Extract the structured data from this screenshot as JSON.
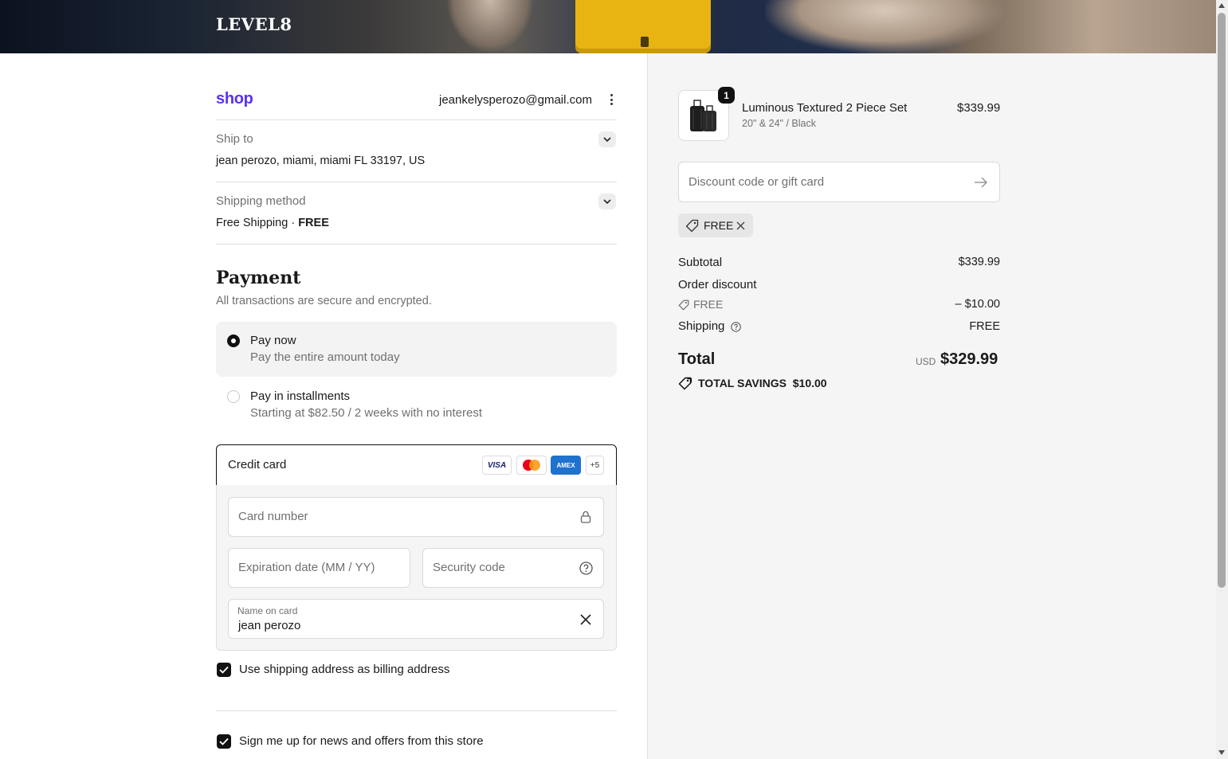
{
  "header": {
    "brand": "LEVEL8"
  },
  "contact": {
    "shop_brand": "shop",
    "email": "jeankelysperozo@gmail.com"
  },
  "ship_to": {
    "label": "Ship to",
    "value": "jean perozo, miami, miami FL 33197, US"
  },
  "shipping_method": {
    "label": "Shipping method",
    "value": "Free Shipping",
    "separator": "·",
    "price": "FREE"
  },
  "payment": {
    "title": "Payment",
    "subtitle": "All transactions are secure and encrypted.",
    "options": [
      {
        "title": "Pay now",
        "subtitle": "Pay the entire amount today",
        "selected": true
      },
      {
        "title": "Pay in installments",
        "subtitle": "Starting at $82.50 / 2 weeks with no interest",
        "selected": false
      }
    ],
    "credit_card": {
      "label": "Credit card",
      "badges": {
        "visa": "VISA",
        "amex": "AMEX",
        "more": "+5"
      },
      "card_number_placeholder": "Card number",
      "expiration_placeholder": "Expiration date (MM / YY)",
      "security_placeholder": "Security code",
      "name_label": "Name on card",
      "name_value": "jean perozo"
    },
    "billing_checkbox": {
      "label": "Use shipping address as billing address",
      "checked": true
    },
    "newsletter_checkbox": {
      "label": "Sign me up for news and offers from this store",
      "checked": true
    }
  },
  "summary": {
    "product": {
      "quantity": "1",
      "name": "Luminous Textured 2 Piece Set",
      "variant": "20\" & 24\" / Black",
      "price": "$339.99"
    },
    "discount_placeholder": "Discount code or gift card",
    "applied_code": "FREE",
    "subtotal_label": "Subtotal",
    "subtotal_value": "$339.99",
    "order_discount_label": "Order discount",
    "order_discount_code": "FREE",
    "order_discount_value": "– $10.00",
    "shipping_label": "Shipping",
    "shipping_value": "FREE",
    "total_label": "Total",
    "currency": "USD",
    "total_value": "$329.99",
    "savings_label": "TOTAL SAVINGS",
    "savings_value": "$10.00"
  },
  "colors": {
    "shop_brand": "#5a31f4",
    "amex": "#1f72cd",
    "visa": "#1a1f71",
    "mastercard_red": "#eb001b",
    "mastercard_yellow": "#f79e1b"
  }
}
